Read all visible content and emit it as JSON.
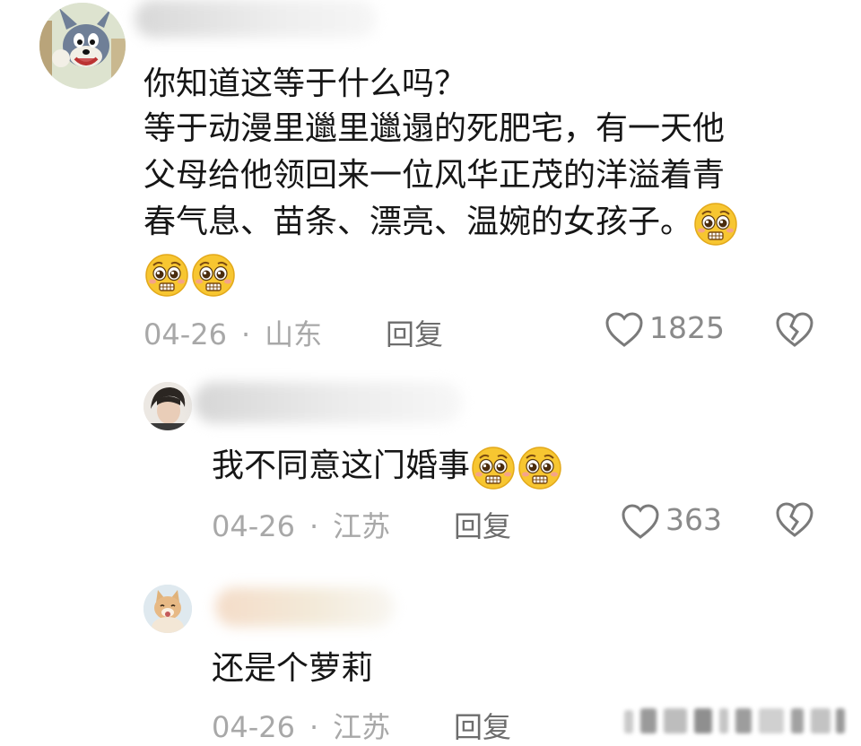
{
  "comments": [
    {
      "text_lines": [
        "你知道这等于什么吗？",
        "等于动漫里邋里邋遢的死肥宅，有一天他",
        "父母给他领回来一位风华正茂的洋溢着青",
        "春气息、苗条、漂亮、温婉的女孩子。"
      ],
      "date": "04-26",
      "location": "山东",
      "reply_label": "回复",
      "likes": "1825",
      "avatar_icon": "tom-cat-avatar"
    },
    {
      "text": "我不同意这门婚事",
      "date": "04-26",
      "location": "江苏",
      "reply_label": "回复",
      "likes": "363",
      "avatar_icon": "person-avatar"
    },
    {
      "text": "还是个萝莉",
      "date": "04-26",
      "location": "江苏",
      "reply_label": "回复",
      "avatar_icon": "cat-avatar"
    }
  ],
  "separator": "·",
  "emoji_name": "pleading-face-emoji",
  "colors": {
    "text": "#161616",
    "meta": "#a8a8a8",
    "icon": "#7a7a7a",
    "emoji_face": "#f7c631"
  }
}
